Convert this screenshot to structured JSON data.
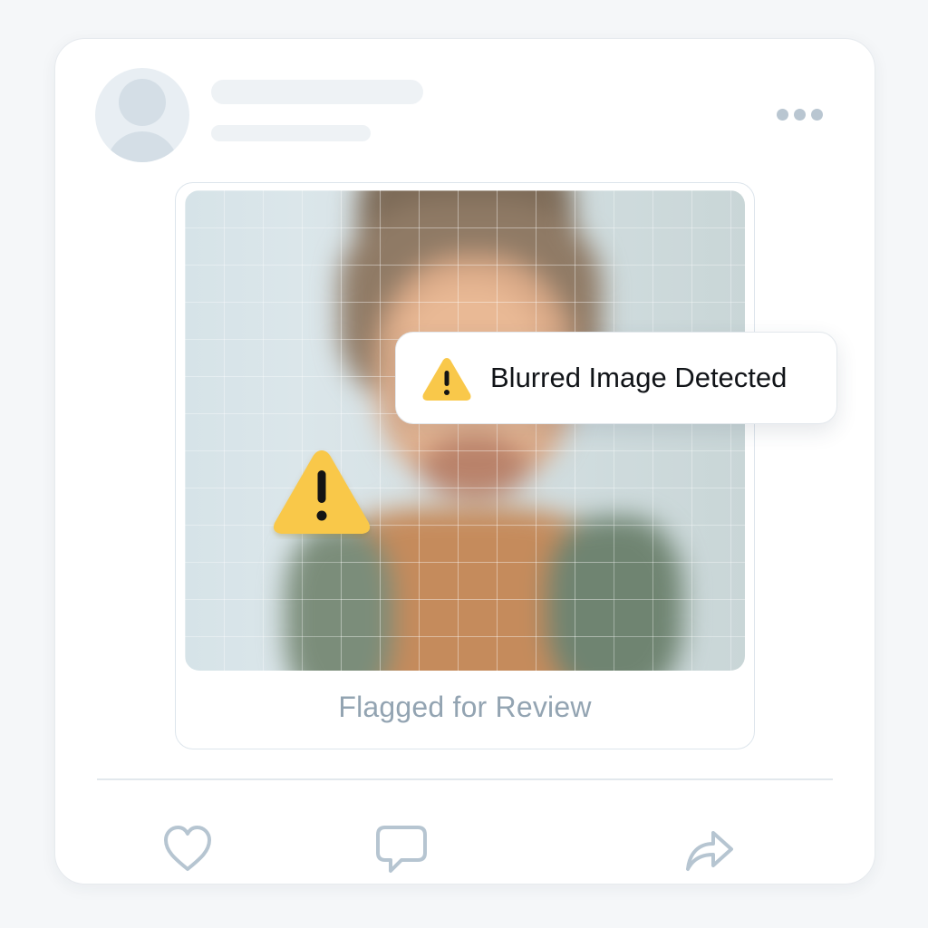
{
  "post": {
    "media": {
      "caption": "Flagged for Review"
    },
    "toast": {
      "text": "Blurred Image Detected"
    },
    "icons": {
      "avatar": "user-avatar-icon",
      "more": "more-horizontal-icon",
      "warning": "warning-triangle-icon",
      "like": "heart-icon",
      "comment": "comment-icon",
      "share": "share-arrow-icon"
    }
  },
  "colors": {
    "warning": "#f9c84a",
    "muted_text": "#93a4b2",
    "icon_stroke": "#b6c5d1",
    "card_bg": "#ffffff",
    "page_bg": "#f5f7f9"
  }
}
